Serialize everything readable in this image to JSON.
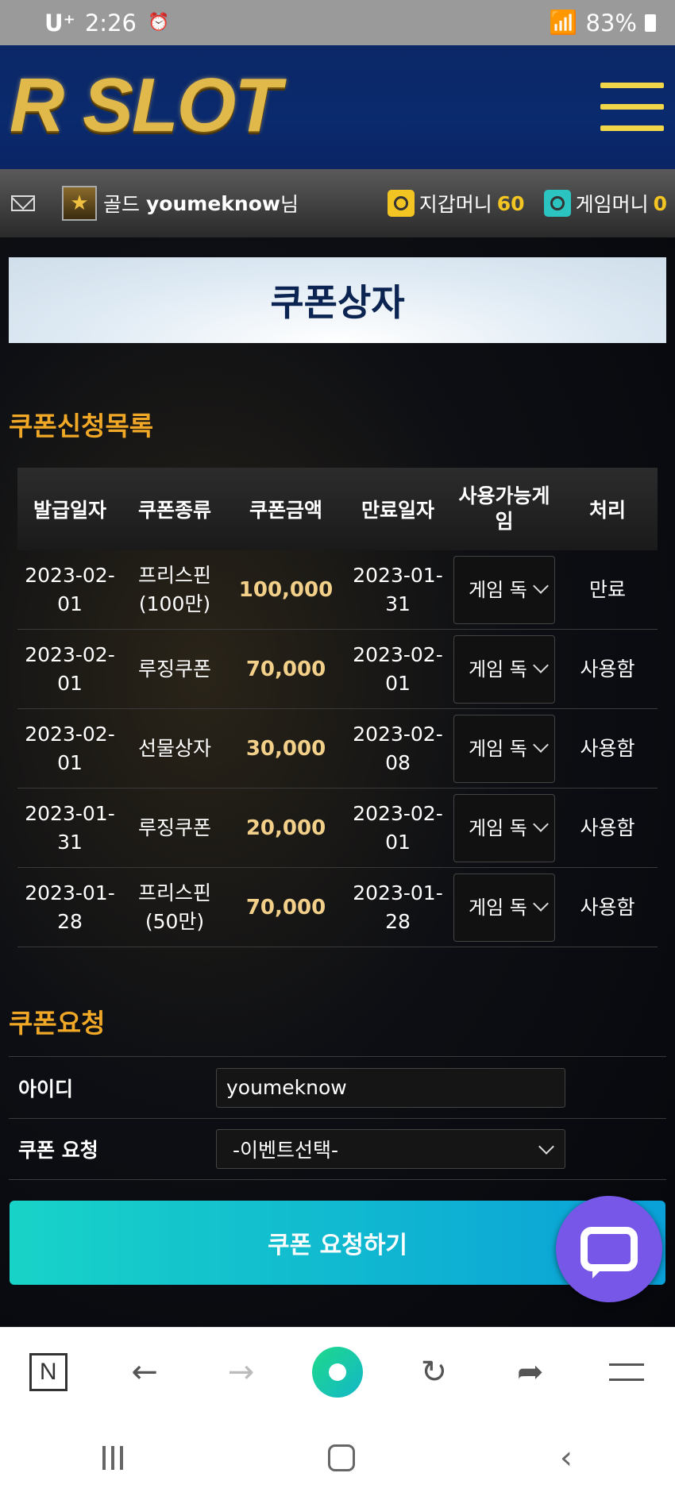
{
  "status_bar": {
    "carrier": "U⁺",
    "time": "2:26",
    "alarm_icon": "alarm-icon",
    "signal": "wifi-signal-icon",
    "battery": "83%"
  },
  "header": {
    "logo_text": "R SLOT",
    "menu_icon": "hamburger-menu-icon"
  },
  "user_bar": {
    "rank": "골드",
    "username": "youmeknow",
    "suffix": "님",
    "wallet_label": "지갑머니",
    "wallet_value": "60",
    "game_label": "게임머니",
    "game_value": "0"
  },
  "page_title": "쿠폰상자",
  "coupon_list": {
    "title": "쿠폰신청목록",
    "headers": [
      "발급일자",
      "쿠폰종류",
      "쿠폰금액",
      "만료일자",
      "사용가능게임",
      "처리"
    ],
    "rows": [
      {
        "issue_date": "2023-02-01",
        "type": "프리스핀(100만)",
        "amount": "100,000",
        "expire_date": "2023-01-31",
        "game": "게임 독",
        "status": "만료"
      },
      {
        "issue_date": "2023-02-01",
        "type": "루징쿠폰",
        "amount": "70,000",
        "expire_date": "2023-02-01",
        "game": "게임 독",
        "status": "사용함"
      },
      {
        "issue_date": "2023-02-01",
        "type": "선물상자",
        "amount": "30,000",
        "expire_date": "2023-02-08",
        "game": "게임 독",
        "status": "사용함"
      },
      {
        "issue_date": "2023-01-31",
        "type": "루징쿠폰",
        "amount": "20,000",
        "expire_date": "2023-02-01",
        "game": "게임 독",
        "status": "사용함"
      },
      {
        "issue_date": "2023-01-28",
        "type": "프리스핀(50만)",
        "amount": "70,000",
        "expire_date": "2023-01-28",
        "game": "게임 독",
        "status": "사용함"
      }
    ]
  },
  "coupon_request": {
    "title": "쿠폰요청",
    "id_label": "아이디",
    "id_value": "youmeknow",
    "request_label": "쿠폰 요청",
    "request_selected": "-이벤트선택-",
    "submit_label": "쿠폰 요청하기"
  },
  "colors": {
    "accent": "#f0a826",
    "header_bg": "#0a2a6e",
    "submit_start": "#18d3c8",
    "submit_end": "#0aa0d8",
    "chat": "#7657e8"
  }
}
